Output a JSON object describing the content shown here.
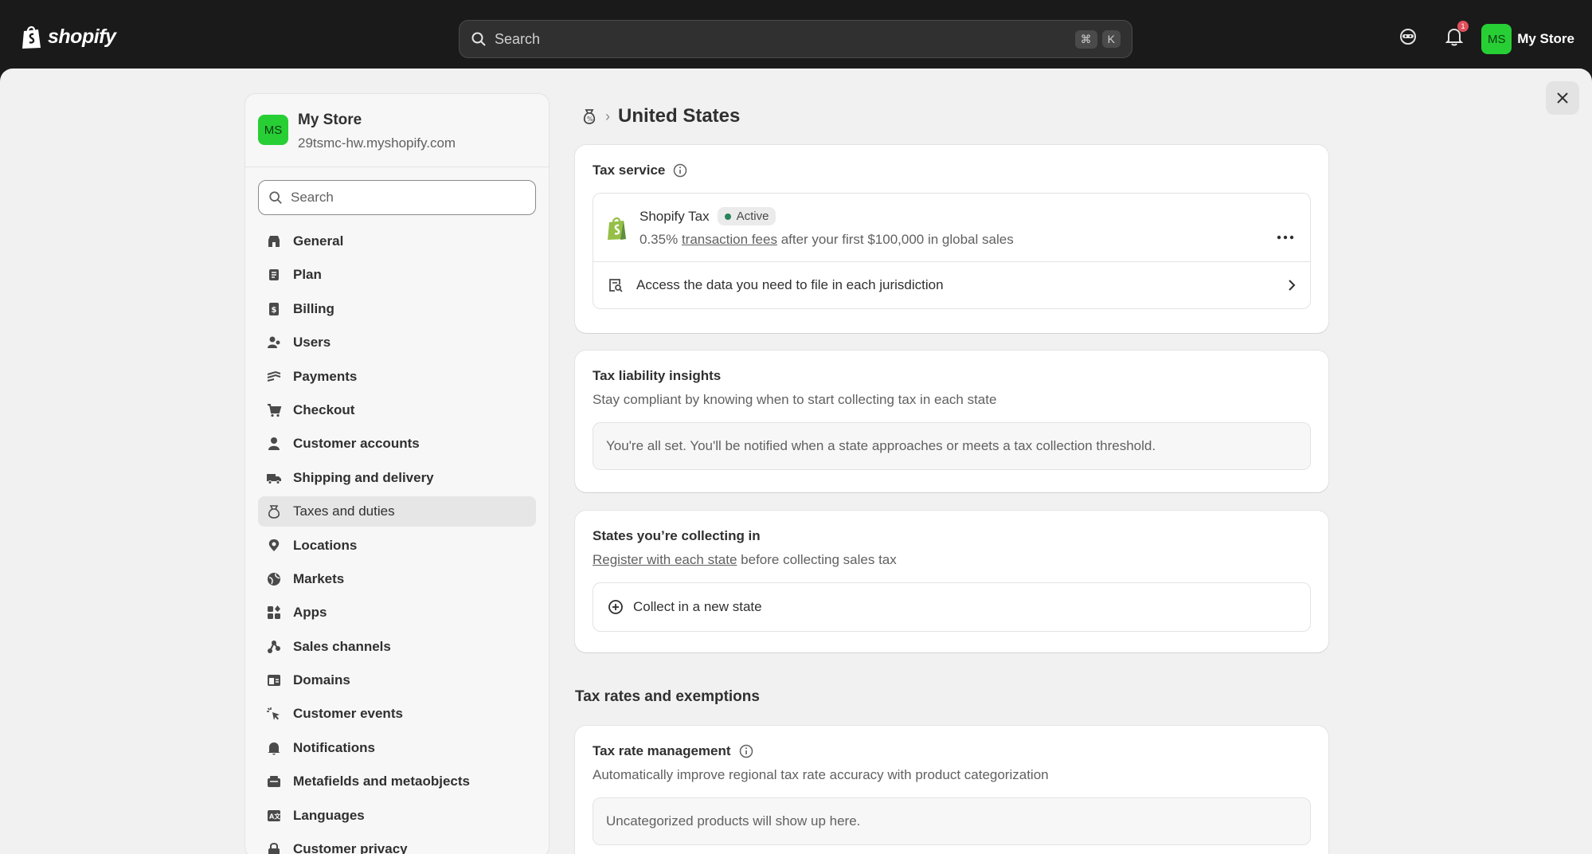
{
  "topbar": {
    "brand": "shopify",
    "search_placeholder": "Search",
    "shortcut_keys": [
      "⌘",
      "K"
    ],
    "notification_count": "1",
    "store_initials": "MS",
    "store_name": "My Store"
  },
  "sidebar": {
    "store_initials": "MS",
    "store_name": "My Store",
    "store_url": "29tsmc-hw.myshopify.com",
    "search_placeholder": "Search",
    "items": [
      {
        "label": "General",
        "icon": "store-icon"
      },
      {
        "label": "Plan",
        "icon": "plan-icon"
      },
      {
        "label": "Billing",
        "icon": "billing-icon"
      },
      {
        "label": "Users",
        "icon": "users-icon"
      },
      {
        "label": "Payments",
        "icon": "payments-icon"
      },
      {
        "label": "Checkout",
        "icon": "cart-icon"
      },
      {
        "label": "Customer accounts",
        "icon": "person-icon"
      },
      {
        "label": "Shipping and delivery",
        "icon": "truck-icon"
      },
      {
        "label": "Taxes and duties",
        "icon": "tax-bag-icon",
        "active": true
      },
      {
        "label": "Locations",
        "icon": "location-pin-icon"
      },
      {
        "label": "Markets",
        "icon": "globe-icon"
      },
      {
        "label": "Apps",
        "icon": "apps-icon"
      },
      {
        "label": "Sales channels",
        "icon": "sales-channels-icon"
      },
      {
        "label": "Domains",
        "icon": "domains-icon"
      },
      {
        "label": "Customer events",
        "icon": "cursor-click-icon"
      },
      {
        "label": "Notifications",
        "icon": "bell-icon"
      },
      {
        "label": "Metafields and metaobjects",
        "icon": "metafields-icon"
      },
      {
        "label": "Languages",
        "icon": "language-icon"
      },
      {
        "label": "Customer privacy",
        "icon": "lock-icon"
      }
    ]
  },
  "page": {
    "title": "United States"
  },
  "tax_service": {
    "title": "Tax service",
    "provider": "Shopify Tax",
    "status": "Active",
    "fee_prefix": "0.35%",
    "fee_link": "transaction fees",
    "fee_suffix": "after your first $100,000 in global sales",
    "access_label": "Access the data you need to file in each jurisdiction"
  },
  "liability": {
    "title": "Tax liability insights",
    "subtitle": "Stay compliant by knowing when to start collecting tax in each state",
    "note": "You're all set. You'll be notified when a state approaches or meets a tax collection threshold."
  },
  "states": {
    "title": "States you’re collecting in",
    "register_link": "Register with each state",
    "register_suffix": "before collecting sales tax",
    "collect_label": "Collect in a new state"
  },
  "rates": {
    "section_title": "Tax rates and exemptions",
    "card_title": "Tax rate management",
    "subtitle": "Automatically improve regional tax rate accuracy with product categorization",
    "note": "Uncategorized products will show up here."
  }
}
